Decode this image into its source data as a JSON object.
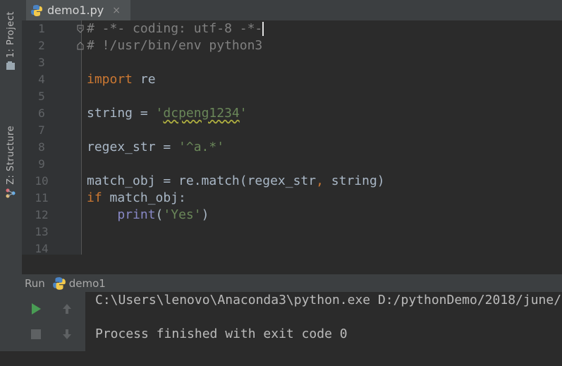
{
  "tab": {
    "filename": "demo1.py",
    "close": "×"
  },
  "sidebar": {
    "project_label": "1: Project",
    "structure_label": "Z: Structure"
  },
  "editor": {
    "line_numbers": [
      "1",
      "2",
      "3",
      "4",
      "5",
      "6",
      "7",
      "8",
      "9",
      "10",
      "11",
      "12",
      "13",
      "14"
    ],
    "lines": {
      "l1": "# -*- coding: utf-8 -*-",
      "l2": "# !/usr/bin/env python3",
      "l4_kw": "import",
      "l4_rest": " re",
      "l6_pre": "string = ",
      "l6_q1": "'",
      "l6_val": "dcpeng1234",
      "l6_q2": "'",
      "l8_pre": "regex_str = ",
      "l8_str": "'^a.*'",
      "l10_pre": "match_obj = re.match(regex_str",
      "l10_comma": ",",
      "l10_post": " string)",
      "l11_kw": "if",
      "l11_rest": " match_obj:",
      "l12_indent": "    ",
      "l12_fn": "print",
      "l12_open": "(",
      "l12_str": "'Yes'",
      "l12_close": ")"
    }
  },
  "run": {
    "label": "Run",
    "config": "demo1",
    "output": [
      "C:\\Users\\lenovo\\Anaconda3\\python.exe D:/pythonDemo/2018/june/",
      "",
      "Process finished with exit code 0"
    ]
  },
  "colors": {
    "keyword": "#cc7832",
    "comment": "#808080",
    "string": "#6a8759",
    "builtin": "#8888c6",
    "text": "#a9b7c6",
    "run_green": "#499c54"
  }
}
